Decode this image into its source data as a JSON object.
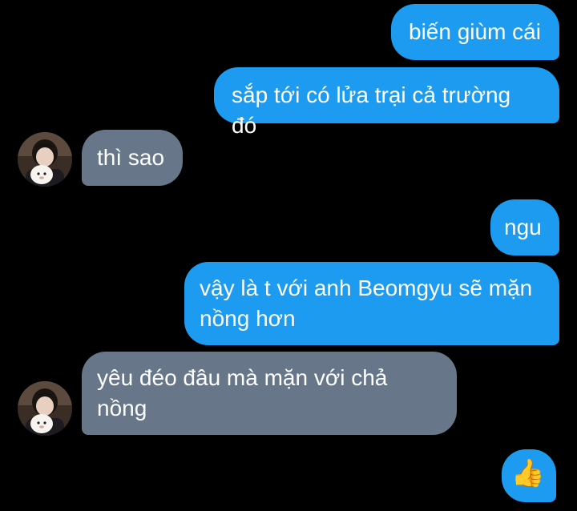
{
  "messages": [
    {
      "id": "m1",
      "direction": "outgoing",
      "text": "biến giùm cái"
    },
    {
      "id": "m2",
      "direction": "outgoing",
      "text": "sắp tới có lửa trại cả trường đó"
    },
    {
      "id": "m3",
      "direction": "incoming",
      "text": "thì sao"
    },
    {
      "id": "m4",
      "direction": "outgoing",
      "text": "ngu"
    },
    {
      "id": "m5",
      "direction": "outgoing",
      "text": "vậy là t với anh Beomgyu sẽ mặn nồng hơn"
    },
    {
      "id": "m6",
      "direction": "incoming",
      "text": "yêu đéo đâu mà mặn với chả nồng"
    },
    {
      "id": "m7",
      "direction": "outgoing",
      "text": "👍"
    }
  ],
  "colors": {
    "background": "#000000",
    "outgoing_bubble": "#1d9bf0",
    "incoming_bubble": "#677789",
    "text": "#ffffff"
  },
  "icons": {
    "avatar": "profile-avatar",
    "reaction": "thumbs-up-emoji"
  }
}
